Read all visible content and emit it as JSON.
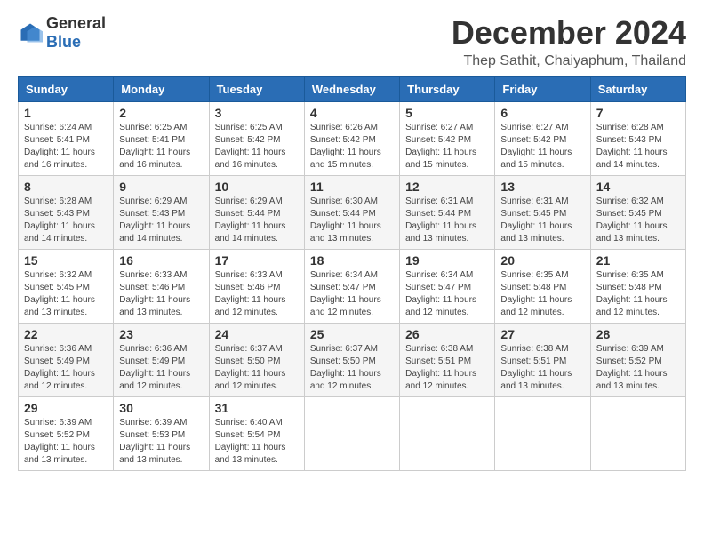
{
  "header": {
    "logo_general": "General",
    "logo_blue": "Blue",
    "month_title": "December 2024",
    "location": "Thep Sathit, Chaiyaphum, Thailand"
  },
  "days_of_week": [
    "Sunday",
    "Monday",
    "Tuesday",
    "Wednesday",
    "Thursday",
    "Friday",
    "Saturday"
  ],
  "weeks": [
    [
      {
        "day": "1",
        "sunrise": "6:24 AM",
        "sunset": "5:41 PM",
        "daylight": "11 hours and 16 minutes."
      },
      {
        "day": "2",
        "sunrise": "6:25 AM",
        "sunset": "5:41 PM",
        "daylight": "11 hours and 16 minutes."
      },
      {
        "day": "3",
        "sunrise": "6:25 AM",
        "sunset": "5:42 PM",
        "daylight": "11 hours and 16 minutes."
      },
      {
        "day": "4",
        "sunrise": "6:26 AM",
        "sunset": "5:42 PM",
        "daylight": "11 hours and 15 minutes."
      },
      {
        "day": "5",
        "sunrise": "6:27 AM",
        "sunset": "5:42 PM",
        "daylight": "11 hours and 15 minutes."
      },
      {
        "day": "6",
        "sunrise": "6:27 AM",
        "sunset": "5:42 PM",
        "daylight": "11 hours and 15 minutes."
      },
      {
        "day": "7",
        "sunrise": "6:28 AM",
        "sunset": "5:43 PM",
        "daylight": "11 hours and 14 minutes."
      }
    ],
    [
      {
        "day": "8",
        "sunrise": "6:28 AM",
        "sunset": "5:43 PM",
        "daylight": "11 hours and 14 minutes."
      },
      {
        "day": "9",
        "sunrise": "6:29 AM",
        "sunset": "5:43 PM",
        "daylight": "11 hours and 14 minutes."
      },
      {
        "day": "10",
        "sunrise": "6:29 AM",
        "sunset": "5:44 PM",
        "daylight": "11 hours and 14 minutes."
      },
      {
        "day": "11",
        "sunrise": "6:30 AM",
        "sunset": "5:44 PM",
        "daylight": "11 hours and 13 minutes."
      },
      {
        "day": "12",
        "sunrise": "6:31 AM",
        "sunset": "5:44 PM",
        "daylight": "11 hours and 13 minutes."
      },
      {
        "day": "13",
        "sunrise": "6:31 AM",
        "sunset": "5:45 PM",
        "daylight": "11 hours and 13 minutes."
      },
      {
        "day": "14",
        "sunrise": "6:32 AM",
        "sunset": "5:45 PM",
        "daylight": "11 hours and 13 minutes."
      }
    ],
    [
      {
        "day": "15",
        "sunrise": "6:32 AM",
        "sunset": "5:45 PM",
        "daylight": "11 hours and 13 minutes."
      },
      {
        "day": "16",
        "sunrise": "6:33 AM",
        "sunset": "5:46 PM",
        "daylight": "11 hours and 13 minutes."
      },
      {
        "day": "17",
        "sunrise": "6:33 AM",
        "sunset": "5:46 PM",
        "daylight": "11 hours and 12 minutes."
      },
      {
        "day": "18",
        "sunrise": "6:34 AM",
        "sunset": "5:47 PM",
        "daylight": "11 hours and 12 minutes."
      },
      {
        "day": "19",
        "sunrise": "6:34 AM",
        "sunset": "5:47 PM",
        "daylight": "11 hours and 12 minutes."
      },
      {
        "day": "20",
        "sunrise": "6:35 AM",
        "sunset": "5:48 PM",
        "daylight": "11 hours and 12 minutes."
      },
      {
        "day": "21",
        "sunrise": "6:35 AM",
        "sunset": "5:48 PM",
        "daylight": "11 hours and 12 minutes."
      }
    ],
    [
      {
        "day": "22",
        "sunrise": "6:36 AM",
        "sunset": "5:49 PM",
        "daylight": "11 hours and 12 minutes."
      },
      {
        "day": "23",
        "sunrise": "6:36 AM",
        "sunset": "5:49 PM",
        "daylight": "11 hours and 12 minutes."
      },
      {
        "day": "24",
        "sunrise": "6:37 AM",
        "sunset": "5:50 PM",
        "daylight": "11 hours and 12 minutes."
      },
      {
        "day": "25",
        "sunrise": "6:37 AM",
        "sunset": "5:50 PM",
        "daylight": "11 hours and 12 minutes."
      },
      {
        "day": "26",
        "sunrise": "6:38 AM",
        "sunset": "5:51 PM",
        "daylight": "11 hours and 12 minutes."
      },
      {
        "day": "27",
        "sunrise": "6:38 AM",
        "sunset": "5:51 PM",
        "daylight": "11 hours and 13 minutes."
      },
      {
        "day": "28",
        "sunrise": "6:39 AM",
        "sunset": "5:52 PM",
        "daylight": "11 hours and 13 minutes."
      }
    ],
    [
      {
        "day": "29",
        "sunrise": "6:39 AM",
        "sunset": "5:52 PM",
        "daylight": "11 hours and 13 minutes."
      },
      {
        "day": "30",
        "sunrise": "6:39 AM",
        "sunset": "5:53 PM",
        "daylight": "11 hours and 13 minutes."
      },
      {
        "day": "31",
        "sunrise": "6:40 AM",
        "sunset": "5:54 PM",
        "daylight": "11 hours and 13 minutes."
      },
      null,
      null,
      null,
      null
    ]
  ]
}
